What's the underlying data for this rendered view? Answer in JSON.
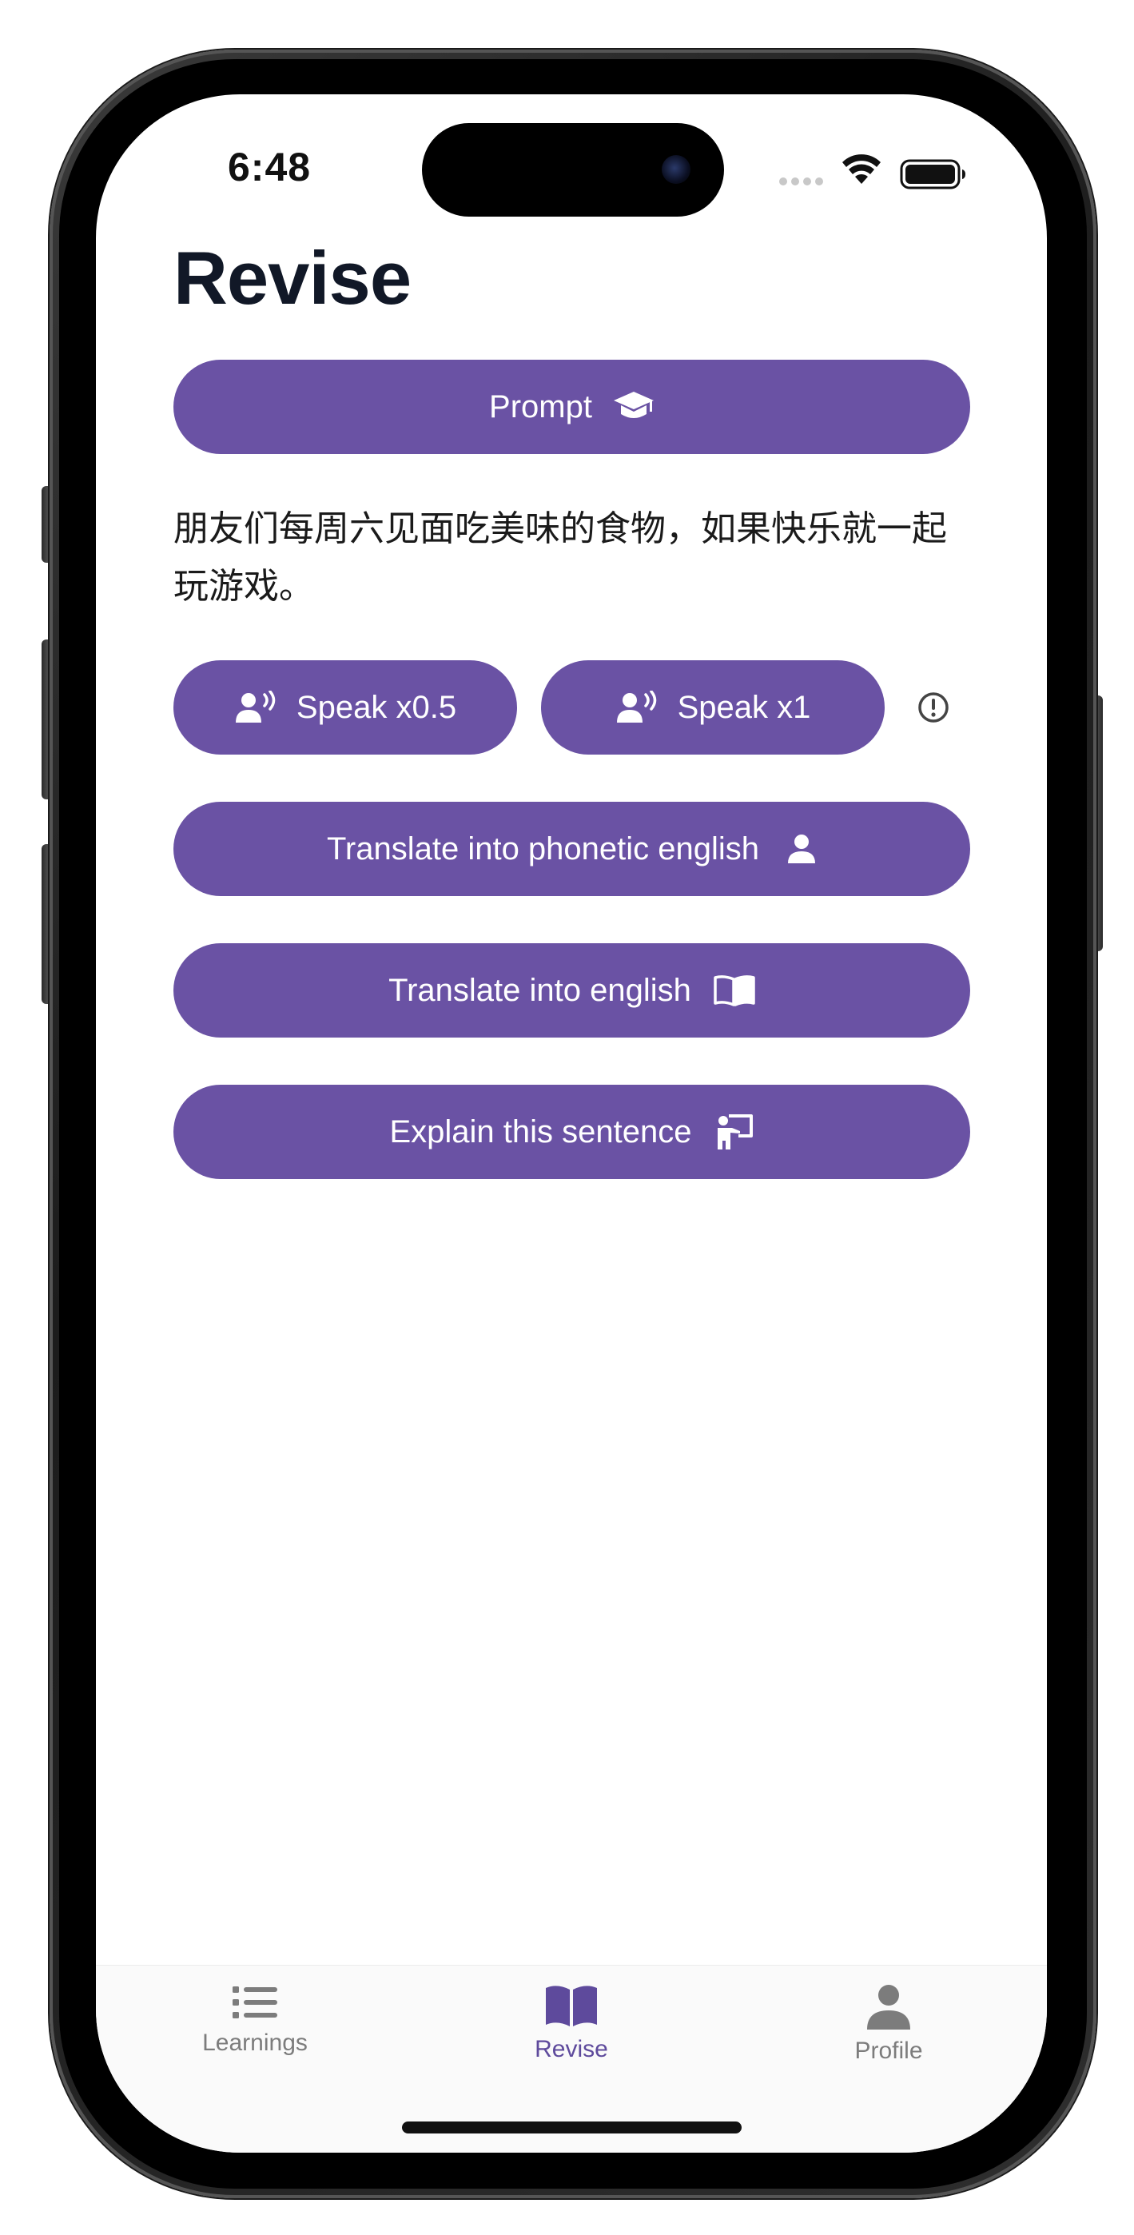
{
  "status_bar": {
    "time": "6:48"
  },
  "page": {
    "title": "Revise"
  },
  "prompt_button": {
    "label": "Prompt",
    "icon": "graduation-cap-icon"
  },
  "sentence": {
    "text": "朋友们每周六见面吃美味的食物，如果快乐就一起玩游戏。"
  },
  "speak": {
    "slow_label": "Speak x0.5",
    "normal_label": "Speak x1",
    "icon": "speaking-person-icon",
    "info_icon": "exclamation-circle-icon"
  },
  "actions": {
    "phonetic_label": "Translate into phonetic english",
    "phonetic_icon": "person-icon",
    "english_label": "Translate into english",
    "english_icon": "open-book-icon",
    "explain_label": "Explain this sentence",
    "explain_icon": "teacher-board-icon"
  },
  "tab_bar": {
    "tabs": [
      {
        "label": "Learnings",
        "icon": "list-icon",
        "active": false
      },
      {
        "label": "Revise",
        "icon": "book-icon",
        "active": true
      },
      {
        "label": "Profile",
        "icon": "person-icon",
        "active": false
      }
    ]
  },
  "colors": {
    "accent": "#6a52a4",
    "tab_active": "#5e4a9c",
    "tab_inactive": "#7c7c7c",
    "title_text": "#111827",
    "background": "#ffffff"
  }
}
